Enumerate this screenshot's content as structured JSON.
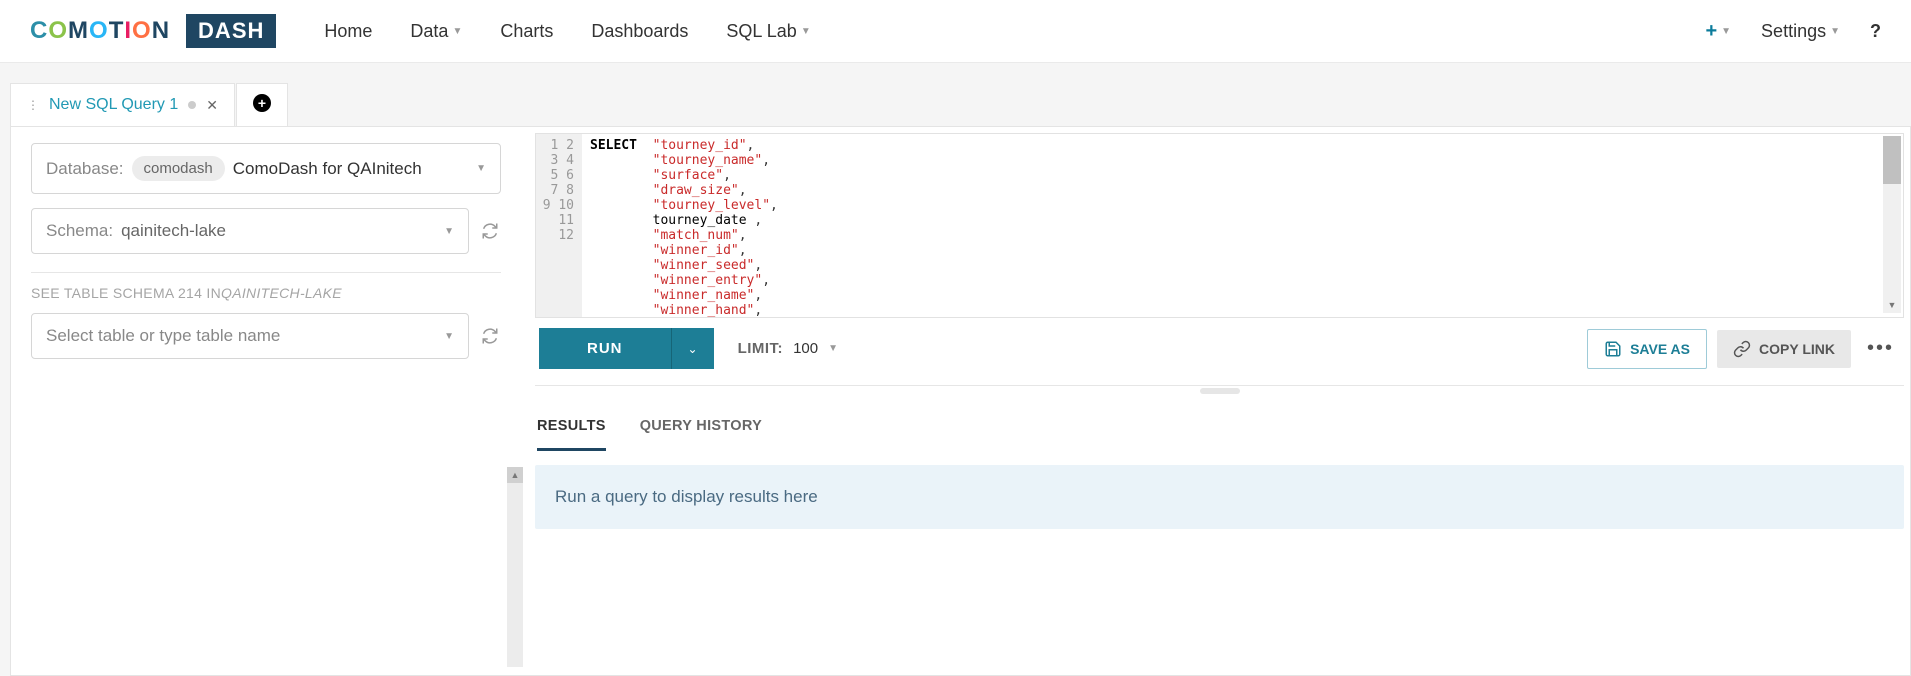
{
  "nav": {
    "home": "Home",
    "data": "Data",
    "charts": "Charts",
    "dashboards": "Dashboards",
    "sqllab": "SQL Lab",
    "settings": "Settings"
  },
  "tabs": {
    "active_label": "New SQL Query 1"
  },
  "sidebar": {
    "database_label": "Database:",
    "database_chip": "comodash",
    "database_name": "ComoDash for QAInitech",
    "schema_label": "Schema:",
    "schema_value": "qainitech-lake",
    "hint_prefix": "SEE TABLE SCHEMA ",
    "hint_count": "214 ",
    "hint_in": "IN",
    "hint_schema": "QAINITECH-LAKE",
    "table_placeholder": "Select table or type table name"
  },
  "editor": {
    "lines": [
      "1",
      "2",
      "3",
      "4",
      "5",
      "6",
      "7",
      "8",
      "9",
      "10",
      "11",
      "12"
    ],
    "code_tokens": [
      [
        {
          "t": "kw",
          "v": "SELECT"
        },
        {
          "t": "p",
          "v": "  "
        },
        {
          "t": "str",
          "v": "\"tourney_id\""
        },
        {
          "t": "p",
          "v": ","
        }
      ],
      [
        {
          "t": "p",
          "v": "        "
        },
        {
          "t": "str",
          "v": "\"tourney_name\""
        },
        {
          "t": "p",
          "v": ","
        }
      ],
      [
        {
          "t": "p",
          "v": "        "
        },
        {
          "t": "str",
          "v": "\"surface\""
        },
        {
          "t": "p",
          "v": ","
        }
      ],
      [
        {
          "t": "p",
          "v": "        "
        },
        {
          "t": "str",
          "v": "\"draw_size\""
        },
        {
          "t": "p",
          "v": ","
        }
      ],
      [
        {
          "t": "p",
          "v": "        "
        },
        {
          "t": "str",
          "v": "\"tourney_level\""
        },
        {
          "t": "p",
          "v": ","
        }
      ],
      [
        {
          "t": "p",
          "v": "        "
        },
        {
          "t": "plain",
          "v": "tourney_date"
        },
        {
          "t": "p",
          "v": " ,"
        }
      ],
      [
        {
          "t": "p",
          "v": "        "
        },
        {
          "t": "str",
          "v": "\"match_num\""
        },
        {
          "t": "p",
          "v": ","
        }
      ],
      [
        {
          "t": "p",
          "v": "        "
        },
        {
          "t": "str",
          "v": "\"winner_id\""
        },
        {
          "t": "p",
          "v": ","
        }
      ],
      [
        {
          "t": "p",
          "v": "        "
        },
        {
          "t": "str",
          "v": "\"winner_seed\""
        },
        {
          "t": "p",
          "v": ","
        }
      ],
      [
        {
          "t": "p",
          "v": "        "
        },
        {
          "t": "str",
          "v": "\"winner_entry\""
        },
        {
          "t": "p",
          "v": ","
        }
      ],
      [
        {
          "t": "p",
          "v": "        "
        },
        {
          "t": "str",
          "v": "\"winner_name\""
        },
        {
          "t": "p",
          "v": ","
        }
      ],
      [
        {
          "t": "p",
          "v": "        "
        },
        {
          "t": "str",
          "v": "\"winner_hand\""
        },
        {
          "t": "p",
          "v": ","
        }
      ]
    ]
  },
  "toolbar": {
    "run": "RUN",
    "limit_label": "LIMIT:",
    "limit_value": "100",
    "saveas": "SAVE AS",
    "copylink": "COPY LINK"
  },
  "results": {
    "tab_results": "RESULTS",
    "tab_history": "QUERY HISTORY",
    "placeholder": "Run a query to display results here"
  }
}
